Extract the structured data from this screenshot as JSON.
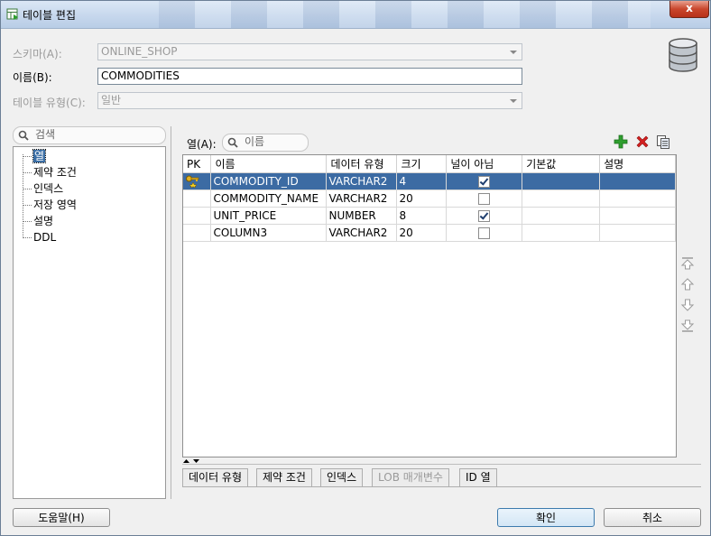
{
  "window": {
    "title": "테이블 편집",
    "close_label": "x"
  },
  "form": {
    "schema_label": "스키마(A):",
    "schema_value": "ONLINE_SHOP",
    "name_label": "이름(B):",
    "name_value": "COMMODITIES",
    "type_label": "테이블 유형(C):",
    "type_value": "일반"
  },
  "left_panel": {
    "search_placeholder": "검색",
    "tree": [
      "열",
      "제약 조건",
      "인덱스",
      "저장 영역",
      "설명",
      "DDL"
    ],
    "selected": "열"
  },
  "columns_panel": {
    "label": "열(A):",
    "search_placeholder": "이름",
    "headers": [
      "PK",
      "이름",
      "데이터 유형",
      "크기",
      "널이 아님",
      "기본값",
      "설명"
    ],
    "rows": [
      {
        "pk": true,
        "name": "COMMODITY_ID",
        "type": "VARCHAR2",
        "size": "4",
        "not_null": true,
        "default": "",
        "comment": "",
        "selected": true
      },
      {
        "pk": false,
        "name": "COMMODITY_NAME",
        "type": "VARCHAR2",
        "size": "20",
        "not_null": false,
        "default": "",
        "comment": "",
        "selected": false
      },
      {
        "pk": false,
        "name": "UNIT_PRICE",
        "type": "NUMBER",
        "size": "8",
        "not_null": true,
        "default": "",
        "comment": "",
        "selected": false
      },
      {
        "pk": false,
        "name": "COLUMN3",
        "type": "VARCHAR2",
        "size": "20",
        "not_null": false,
        "default": "",
        "comment": "",
        "selected": false
      }
    ],
    "tools": {
      "add_icon": "plus-icon",
      "delete_icon": "delete-x-icon",
      "copy_icon": "copy-icon"
    },
    "tabs": [
      "데이터 유형",
      "제약 조건",
      "인덱스",
      "LOB 매개변수",
      "ID 열"
    ],
    "disabled_tab": "LOB 매개변수"
  },
  "buttons": {
    "help": "도움말(H)",
    "ok": "확인",
    "cancel": "취소"
  },
  "colors": {
    "selection": "#3c6ba3",
    "add": "#2e9e2e",
    "delete": "#d42020"
  }
}
